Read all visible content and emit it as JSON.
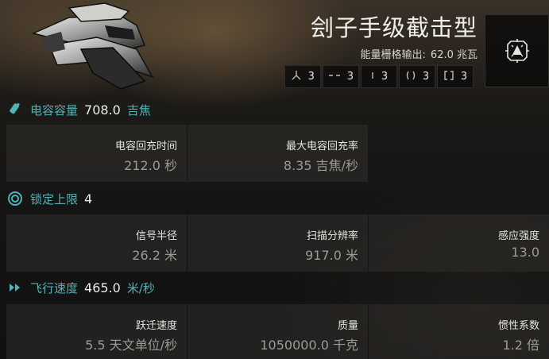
{
  "ship": {
    "name": "刽子手级截击型",
    "power_grid_label": "能量栅格输出:",
    "power_grid_value": "62.0 兆瓦"
  },
  "slots": [
    {
      "icon": "high-slot-icon",
      "glyph": "⅄",
      "count": "3"
    },
    {
      "icon": "mid-slot-icon",
      "glyph": "--",
      "count": "3"
    },
    {
      "icon": "low-slot-icon",
      "glyph": "ı",
      "count": "3"
    },
    {
      "icon": "rig-slot-icon",
      "glyph": "()",
      "count": "3"
    },
    {
      "icon": "subsystem-slot-icon",
      "glyph": "[]",
      "count": "3"
    }
  ],
  "capacitor": {
    "label": "电容容量",
    "value": "708.0",
    "unit": "吉焦",
    "stats": [
      {
        "label": "电容回充时间",
        "value": "212.0 秒"
      },
      {
        "label": "最大电容回充率",
        "value": "8.35 吉焦/秒"
      }
    ]
  },
  "targeting": {
    "label": "锁定上限",
    "value": "4",
    "stats": [
      {
        "label": "信号半径",
        "value": "26.2 米"
      },
      {
        "label": "扫描分辨率",
        "value": "917.0 米"
      },
      {
        "label": "感应强度",
        "value": "13.0"
      }
    ]
  },
  "navigation": {
    "label": "飞行速度",
    "value": "465.0",
    "unit": "米/秒",
    "stats": [
      {
        "label": "跃迁速度",
        "value": "5.5 天文单位/秒"
      },
      {
        "label": "质量",
        "value": "1050000.0 千克"
      },
      {
        "label": "惯性系数",
        "value": "1.2 倍"
      }
    ]
  },
  "colors": {
    "accent": "#4fb4b8",
    "panel": "#2e2c29",
    "muted_value": "#9c9a95"
  }
}
